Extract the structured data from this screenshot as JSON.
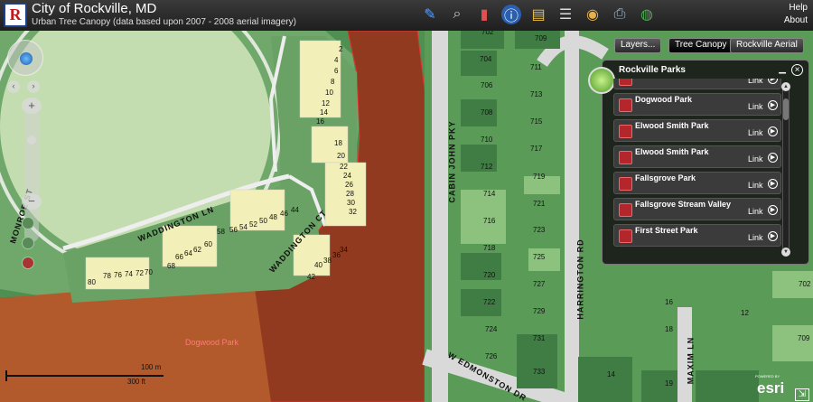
{
  "header": {
    "title": "City of Rockville, MD",
    "subtitle": "Urban Tree Canopy (data based upon 2007 - 2008 aerial imagery)",
    "logo_letter": "R",
    "links": [
      "Help",
      "About"
    ],
    "tools": [
      {
        "name": "draw-icon",
        "glyph": "✎"
      },
      {
        "name": "binoculars-icon",
        "glyph": "⌕"
      },
      {
        "name": "bookmark-icon",
        "glyph": "▮"
      },
      {
        "name": "info-icon",
        "glyph": "ⓘ"
      },
      {
        "name": "folder-icon",
        "glyph": "▤"
      },
      {
        "name": "list-icon",
        "glyph": "☰"
      },
      {
        "name": "palette-icon",
        "glyph": "◉"
      },
      {
        "name": "print-icon",
        "glyph": "⎙"
      },
      {
        "name": "globe-icon",
        "glyph": "◍"
      }
    ]
  },
  "layer_buttons": {
    "layers": "Layers...",
    "tree_canopy": "Tree Canopy",
    "rockville_aerial": "Rockville Aerial"
  },
  "panel": {
    "title": "Rockville Parks",
    "link_label": "Link",
    "items": [
      "",
      "Dogwood Park",
      "Elwood Smith Park",
      "Elwood Smith Park",
      "Fallsgrove Park",
      "Fallsgrove Stream Valley",
      "First Street Park"
    ]
  },
  "map": {
    "streets": [
      "MONROE ST",
      "WADDINGTON LN",
      "WADDINGTON CT",
      "CABIN JOHN PKY",
      "HARRINGTON RD",
      "W EDMONSTON DR",
      "MAXIM LN"
    ],
    "park_label": "Dogwood Park",
    "lot_numbers": [
      "2",
      "4",
      "6",
      "8",
      "10",
      "12",
      "14",
      "16",
      "18",
      "20",
      "22",
      "24",
      "26",
      "28",
      "30",
      "32",
      "40",
      "38",
      "36",
      "34",
      "42",
      "44",
      "46",
      "48",
      "50",
      "52",
      "54",
      "56",
      "58",
      "60",
      "62",
      "64",
      "66",
      "68",
      "70",
      "72",
      "74",
      "76",
      "78",
      "80",
      "702",
      "704",
      "706",
      "708",
      "710",
      "712",
      "714",
      "716",
      "718",
      "720",
      "722",
      "724",
      "726",
      "709",
      "711",
      "713",
      "715",
      "717",
      "719",
      "721",
      "723",
      "725",
      "727",
      "729",
      "731",
      "733",
      "16",
      "18",
      "19",
      "14",
      "12",
      "709",
      "702"
    ]
  },
  "scale": {
    "metric": "100 m",
    "imperial": "300 ft"
  },
  "attribution": {
    "powered": "POWERED BY",
    "brand": "esri"
  },
  "colors": {
    "park_fill": "#9a3d1e",
    "canopy_light": "#7fb77a",
    "canopy_dark": "#4d8a4f",
    "panel_bg": "#1e1e1e",
    "park_marker": "#b3262b"
  }
}
